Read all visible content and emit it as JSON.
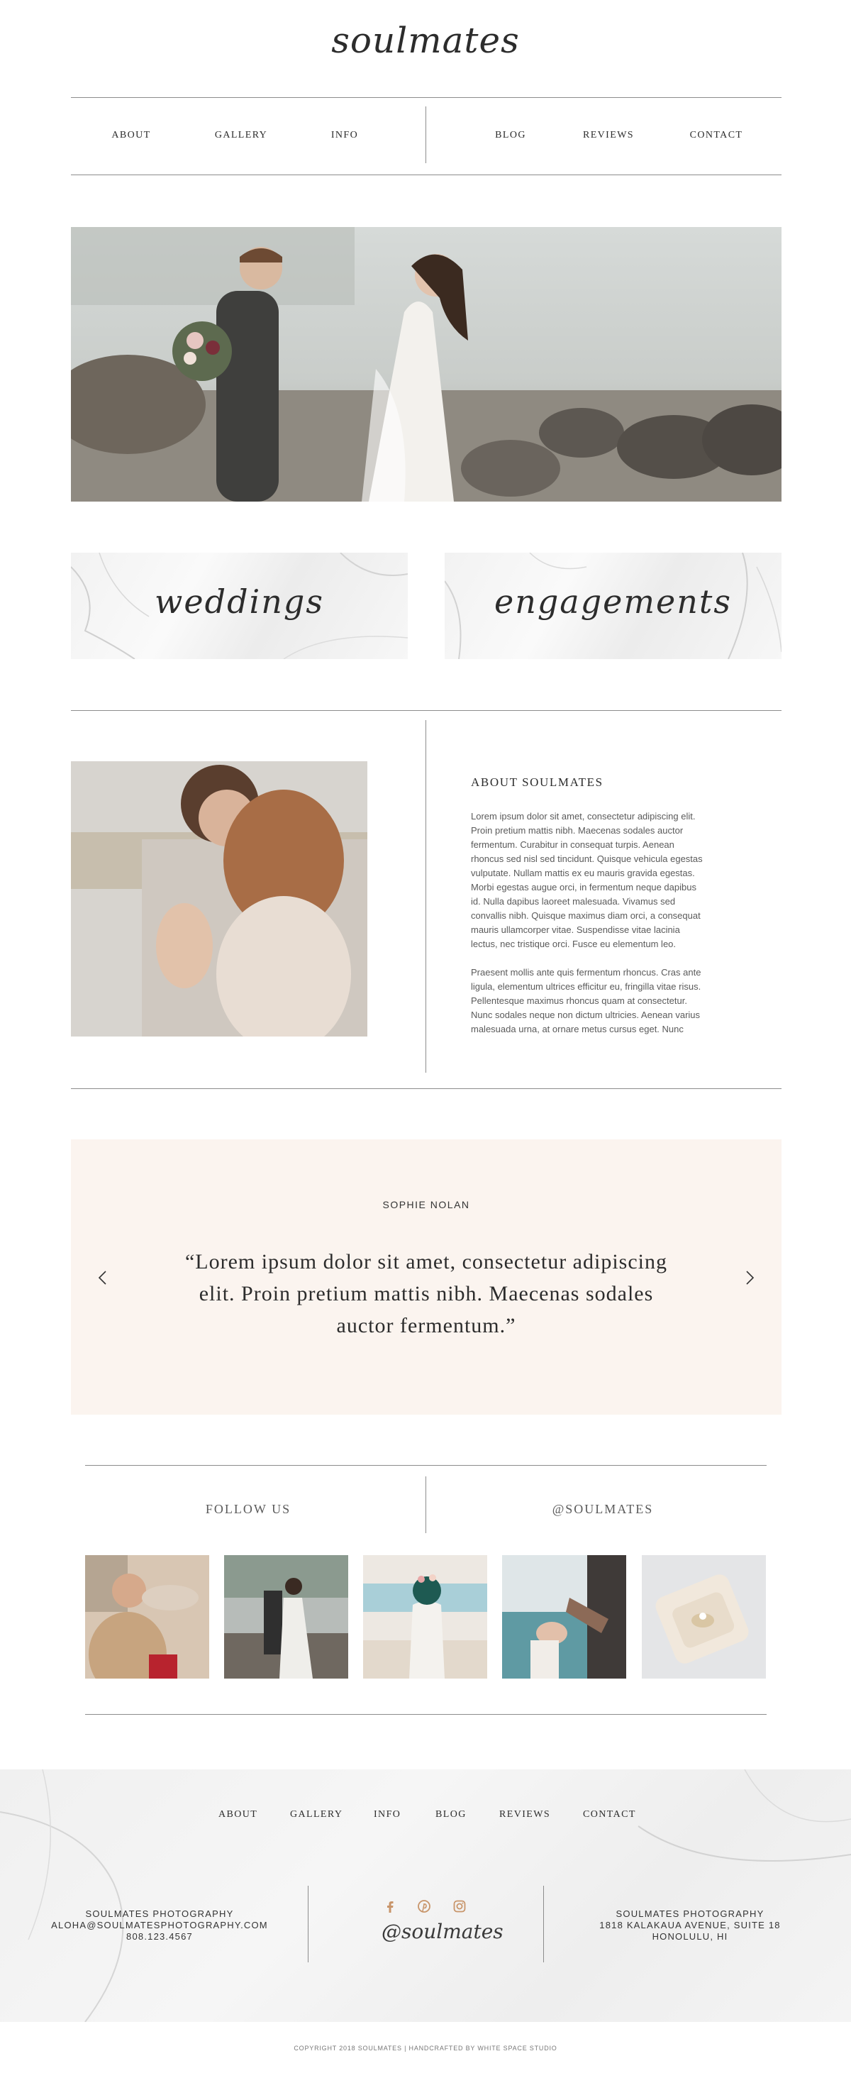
{
  "brand": {
    "logo": "soulmates"
  },
  "nav": {
    "left": [
      "ABOUT",
      "GALLERY",
      "INFO"
    ],
    "right": [
      "BLOG",
      "REVIEWS",
      "CONTACT"
    ]
  },
  "categories": [
    "weddings",
    "engagements"
  ],
  "about": {
    "title": "ABOUT SOULMATES",
    "paragraphs": [
      [
        "Lorem ipsum dolor sit amet, consectetur adipiscing elit.",
        "Proin pretium mattis nibh. Maecenas sodales auctor",
        "fermentum. Curabitur in consequat turpis. Aenean",
        "rhoncus sed nisl sed tincidunt. Quisque vehicula egestas",
        "vulputate. Nullam mattis ex eu mauris gravida egestas.",
        "Morbi egestas augue orci, in fermentum neque dapibus",
        "id. Nulla dapibus laoreet malesuada. Vivamus sed",
        "convallis nibh. Quisque maximus diam orci, a consequat",
        "mauris ullamcorper vitae. Suspendisse vitae lacinia",
        "lectus, nec tristique orci. Fusce eu elementum leo."
      ],
      [
        "Praesent mollis ante quis fermentum rhoncus. Cras ante",
        "ligula, elementum ultrices efficitur eu, fringilla vitae risus.",
        "Pellentesque maximus rhoncus quam at consectetur.",
        "Nunc sodales neque non dictum ultricies. Aenean varius",
        "malesuada urna, at ornare metus cursus eget. Nunc"
      ]
    ]
  },
  "testimonial": {
    "name": "SOPHIE NOLAN",
    "quote_lines": [
      "“Lorem ipsum dolor sit amet, consectetur adipiscing",
      "elit. Proin pretium mattis nibh. Maecenas sodales",
      "auctor fermentum.”"
    ]
  },
  "follow": {
    "label": "FOLLOW US",
    "handle": "@SOULMATES"
  },
  "footer": {
    "nav": [
      "ABOUT",
      "GALLERY",
      "INFO",
      "BLOG",
      "REVIEWS",
      "CONTACT"
    ],
    "left_info": [
      "SOULMATES PHOTOGRAPHY",
      "ALOHA@SOULMATESPHOTOGRAPHY.COM",
      "808.123.4567"
    ],
    "right_info": [
      "SOULMATES PHOTOGRAPHY",
      "1818 KALAKAUA AVENUE, SUITE 18",
      "HONOLULU, HI"
    ],
    "signature": "@soulmates",
    "social_icons": [
      "facebook-icon",
      "pinterest-icon",
      "instagram-icon"
    ],
    "copyright": "COPYRIGHT 2018 SOULMATES | HANDCRAFTED BY WHITE SPACE STUDIO"
  },
  "colors": {
    "accent": "#c8956a",
    "testimonial_bg": "#fbf4ef",
    "rule": "#8c8c8c"
  }
}
